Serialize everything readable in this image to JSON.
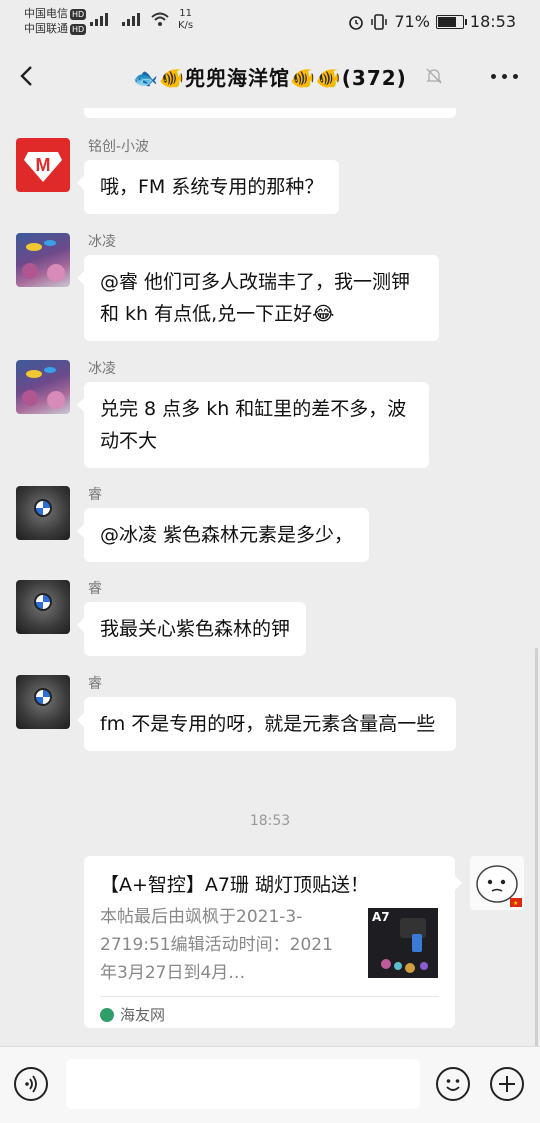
{
  "status_bar": {
    "carrier1": "中国电信",
    "carrier2": "中国联通",
    "hd": "HD",
    "net_type": "4G",
    "speed_value": "11",
    "speed_unit": "K/s",
    "battery": "71%",
    "time": "18:53"
  },
  "header": {
    "title": "🐟🐠兜兜海洋馆🐠🐠(372)",
    "mute_icon": "bell-off-icon",
    "more_icon": "more-dots-icon"
  },
  "messages": [
    {
      "sender": "铭创-小波",
      "text": "哦，FM 系统专用的那种？"
    },
    {
      "sender": "冰凌",
      "text": "@睿  他们可多人改瑞丰了，我一测钾和 kh 有点低,兑一下正好😂"
    },
    {
      "sender": "冰凌",
      "text": "兑完 8 点多 kh 和缸里的差不多，波动不大"
    },
    {
      "sender": "睿",
      "text": "@冰凌  紫色森林元素是多少，"
    },
    {
      "sender": "睿",
      "text": "我最关心紫色森林的钾"
    },
    {
      "sender": "睿",
      "text": "fm 不是专用的呀，就是元素含量高一些"
    }
  ],
  "timestamp": "18:53",
  "card": {
    "title": "【A+智控】A7珊 瑚灯顶贴送！",
    "description": "本帖最后由飒枫于2021-3-2719:51编辑活动时间：2021年3月27日到4月…",
    "thumb_label": "A7",
    "source": "海友网"
  },
  "colors": {
    "background": "#ededed",
    "bubble": "#ffffff",
    "meta": "#999999"
  }
}
